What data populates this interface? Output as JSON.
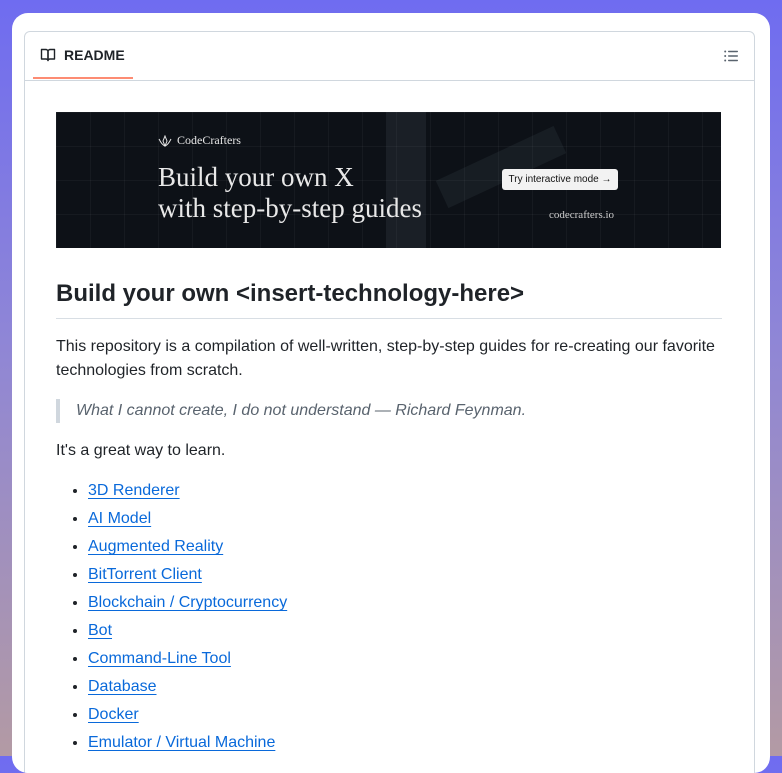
{
  "header": {
    "tab_label": "README",
    "tab_icon": "book-icon",
    "outline_icon": "list-unordered-icon",
    "tab_accent": "#fd8c73"
  },
  "banner": {
    "brand": "CodeCrafters",
    "headline_line1": "Build your own X",
    "headline_line2": "with step-by-step guides",
    "cta": "Try interactive mode →",
    "domain": "codecrafters.io"
  },
  "main": {
    "title": "Build your own <insert-technology-here>",
    "intro": "This repository is a compilation of well-written, step-by-step guides for re-creating our favorite technologies from scratch.",
    "quote": "What I cannot create, I do not understand — Richard Feynman.",
    "learn": "It's a great way to learn.",
    "topics": [
      "3D Renderer",
      "AI Model",
      "Augmented Reality",
      "BitTorrent Client",
      "Blockchain / Cryptocurrency",
      "Bot",
      "Command-Line Tool",
      "Database",
      "Docker",
      "Emulator / Virtual Machine"
    ]
  },
  "colors": {
    "link": "#0969da",
    "text": "#1f2328",
    "muted": "#59636e",
    "border": "#d0d7de",
    "banner_bg": "#0d1117"
  }
}
